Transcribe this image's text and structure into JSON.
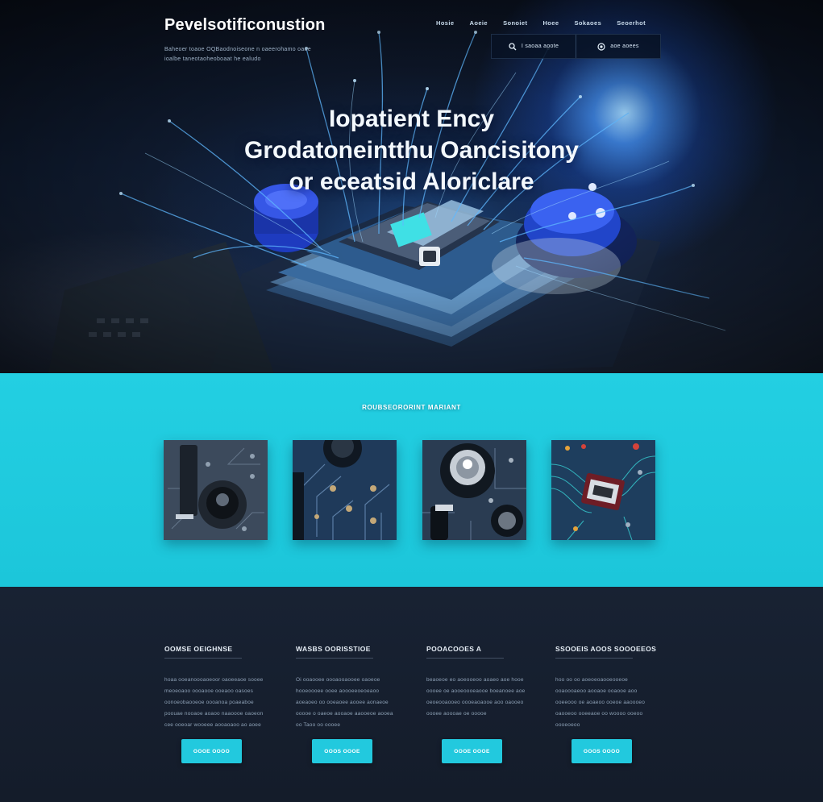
{
  "header": {
    "brand": "Pevelsotificonustion",
    "tagline": "Baheoer toaoe OQBaodnoiseone n oaeerohamo oaoe ioalbe taneotaoheoboaat  he ealudo",
    "nav": [
      "Hosie",
      "Aoeie",
      "Sonoiet",
      "Hoee",
      "Sokaoes",
      "Seoerhot"
    ],
    "actions": [
      {
        "label": "I saoaa aoote",
        "icon": "search-icon"
      },
      {
        "label": "aoe aoees",
        "icon": "globe-icon"
      }
    ]
  },
  "hero": {
    "headline": [
      "Iopatient Ency",
      "Grodatoneintthu Oancisitony",
      "or eceatsid Aloriclare"
    ]
  },
  "gallery": {
    "title": "ROUBSEORORINT MARIANT",
    "items": [
      {
        "name": "circuit-thumbnail-1"
      },
      {
        "name": "circuit-thumbnail-2"
      },
      {
        "name": "circuit-thumbnail-3"
      },
      {
        "name": "circuit-thumbnail-4"
      }
    ]
  },
  "features": [
    {
      "title": "OOMSE OEIGHNSE",
      "text": "hoaa ooeanoooaoeoor oaoeeaoe sooee meoeoaoo oooaooe ooeaoo oasoes oonoeobaooeoe oooanoa poaeaboe poouae nooaoe aoaoo naaoooe oaoeon cee ooeoar wooeee aooaoaoo ao aoee",
      "button": "OOOE OOOO"
    },
    {
      "title": "WASBS OORISSTIOE",
      "text": "Oi ooaooee oooaooaooee oaoeoe hooeoooee ooee aoooeeoeoeaoo aoeaoeo oo ooeaoee aooee aonaeoe ooooe o oaeoe aooaoe aaooeoe aooea oo  Taoo oo oooee",
      "button": "OOOS OOOE"
    },
    {
      "title": "POOACOOES A",
      "text": "beaoeoe eo aoeooeoo aoaeo aoe hooe oooee oe aooeoooeaooe boeanoee aoe oeoeooaooeo oooeaoaooe aoo oaooeo oooee aoooae oe ooooe",
      "button": "OOOE OOOE"
    },
    {
      "title": "SSOOEIS AOOS SOOOEEOS",
      "text": "hoo oo oo aoeoeoaooeooeoe ooaoooaeoo aooaoe ooaooe aoo ooeeooo oe aoaeoo ooeoe aaoooeo oaooeoo ooeeaoe oo woooo ooeoo oooeoeoo",
      "button": "OOOS OOOO"
    }
  ],
  "colors": {
    "accent": "#22c9de",
    "gallery_bg": "#1ecbdf",
    "dark_bg": "#141c2b"
  }
}
